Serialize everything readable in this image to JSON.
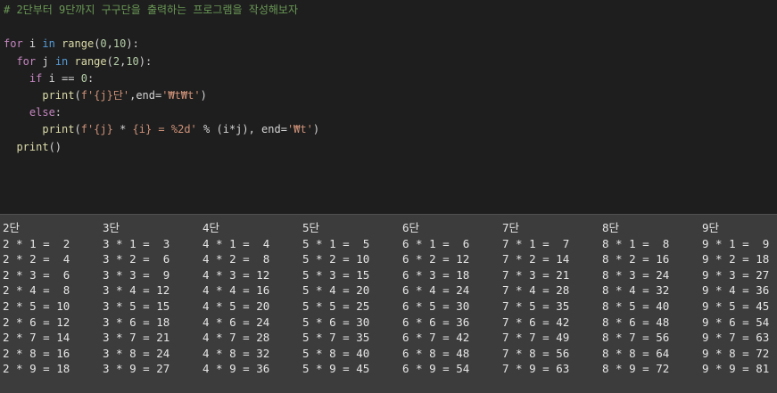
{
  "editor": {
    "lines": [
      [
        {
          "t": "# 2단부터 9단까지 구구단을 출력하는 프로그램을 작성해보자",
          "c": "comment"
        }
      ],
      [],
      [
        {
          "t": "for",
          "c": "kw"
        },
        {
          "t": " i ",
          "c": "op"
        },
        {
          "t": "in",
          "c": "kw2"
        },
        {
          "t": " ",
          "c": "op"
        },
        {
          "t": "range",
          "c": "fn"
        },
        {
          "t": "(",
          "c": "op"
        },
        {
          "t": "0",
          "c": "num"
        },
        {
          "t": ",",
          "c": "op"
        },
        {
          "t": "10",
          "c": "num"
        },
        {
          "t": "):",
          "c": "op"
        }
      ],
      [
        {
          "t": "  for",
          "c": "kw"
        },
        {
          "t": " j ",
          "c": "op"
        },
        {
          "t": "in",
          "c": "kw2"
        },
        {
          "t": " ",
          "c": "op"
        },
        {
          "t": "range",
          "c": "fn"
        },
        {
          "t": "(",
          "c": "op"
        },
        {
          "t": "2",
          "c": "num"
        },
        {
          "t": ",",
          "c": "op"
        },
        {
          "t": "10",
          "c": "num"
        },
        {
          "t": "):",
          "c": "op"
        }
      ],
      [
        {
          "t": "    if",
          "c": "kw"
        },
        {
          "t": " i == ",
          "c": "op"
        },
        {
          "t": "0",
          "c": "num"
        },
        {
          "t": ":",
          "c": "op"
        }
      ],
      [
        {
          "t": "      print",
          "c": "fn"
        },
        {
          "t": "(",
          "c": "op"
        },
        {
          "t": "f'{j}단'",
          "c": "str"
        },
        {
          "t": ",end=",
          "c": "op"
        },
        {
          "t": "'₩t₩t'",
          "c": "str"
        },
        {
          "t": ")",
          "c": "op"
        }
      ],
      [
        {
          "t": "    else",
          "c": "kw"
        },
        {
          "t": ":",
          "c": "op"
        }
      ],
      [
        {
          "t": "      print",
          "c": "fn"
        },
        {
          "t": "(",
          "c": "op"
        },
        {
          "t": "f'{j} ",
          "c": "str"
        },
        {
          "t": "*",
          "c": "op"
        },
        {
          "t": " {i} = %2d'",
          "c": "str"
        },
        {
          "t": " % (i*j), end=",
          "c": "op"
        },
        {
          "t": "'₩t'",
          "c": "str"
        },
        {
          "t": ")",
          "c": "op"
        }
      ],
      [
        {
          "t": "  print",
          "c": "fn"
        },
        {
          "t": "()",
          "c": "op"
        }
      ]
    ]
  },
  "output": {
    "columns": [
      [
        "2단",
        "2 * 1 =  2",
        "2 * 2 =  4",
        "2 * 3 =  6",
        "2 * 4 =  8",
        "2 * 5 = 10",
        "2 * 6 = 12",
        "2 * 7 = 14",
        "2 * 8 = 16",
        "2 * 9 = 18"
      ],
      [
        "3단",
        "3 * 1 =  3",
        "3 * 2 =  6",
        "3 * 3 =  9",
        "3 * 4 = 12",
        "3 * 5 = 15",
        "3 * 6 = 18",
        "3 * 7 = 21",
        "3 * 8 = 24",
        "3 * 9 = 27"
      ],
      [
        "4단",
        "4 * 1 =  4",
        "4 * 2 =  8",
        "4 * 3 = 12",
        "4 * 4 = 16",
        "4 * 5 = 20",
        "4 * 6 = 24",
        "4 * 7 = 28",
        "4 * 8 = 32",
        "4 * 9 = 36"
      ],
      [
        "5단",
        "5 * 1 =  5",
        "5 * 2 = 10",
        "5 * 3 = 15",
        "5 * 4 = 20",
        "5 * 5 = 25",
        "5 * 6 = 30",
        "5 * 7 = 35",
        "5 * 8 = 40",
        "5 * 9 = 45"
      ],
      [
        "6단",
        "6 * 1 =  6",
        "6 * 2 = 12",
        "6 * 3 = 18",
        "6 * 4 = 24",
        "6 * 5 = 30",
        "6 * 6 = 36",
        "6 * 7 = 42",
        "6 * 8 = 48",
        "6 * 9 = 54"
      ],
      [
        "7단",
        "7 * 1 =  7",
        "7 * 2 = 14",
        "7 * 3 = 21",
        "7 * 4 = 28",
        "7 * 5 = 35",
        "7 * 6 = 42",
        "7 * 7 = 49",
        "7 * 8 = 56",
        "7 * 9 = 63"
      ],
      [
        "8단",
        "8 * 1 =  8",
        "8 * 2 = 16",
        "8 * 3 = 24",
        "8 * 4 = 32",
        "8 * 5 = 40",
        "8 * 6 = 48",
        "8 * 7 = 56",
        "8 * 8 = 64",
        "8 * 9 = 72"
      ],
      [
        "9단",
        "9 * 1 =  9",
        "9 * 2 = 18",
        "9 * 3 = 27",
        "9 * 4 = 36",
        "9 * 5 = 45",
        "9 * 6 = 54",
        "9 * 7 = 63",
        "9 * 8 = 72",
        "9 * 9 = 81"
      ]
    ]
  }
}
